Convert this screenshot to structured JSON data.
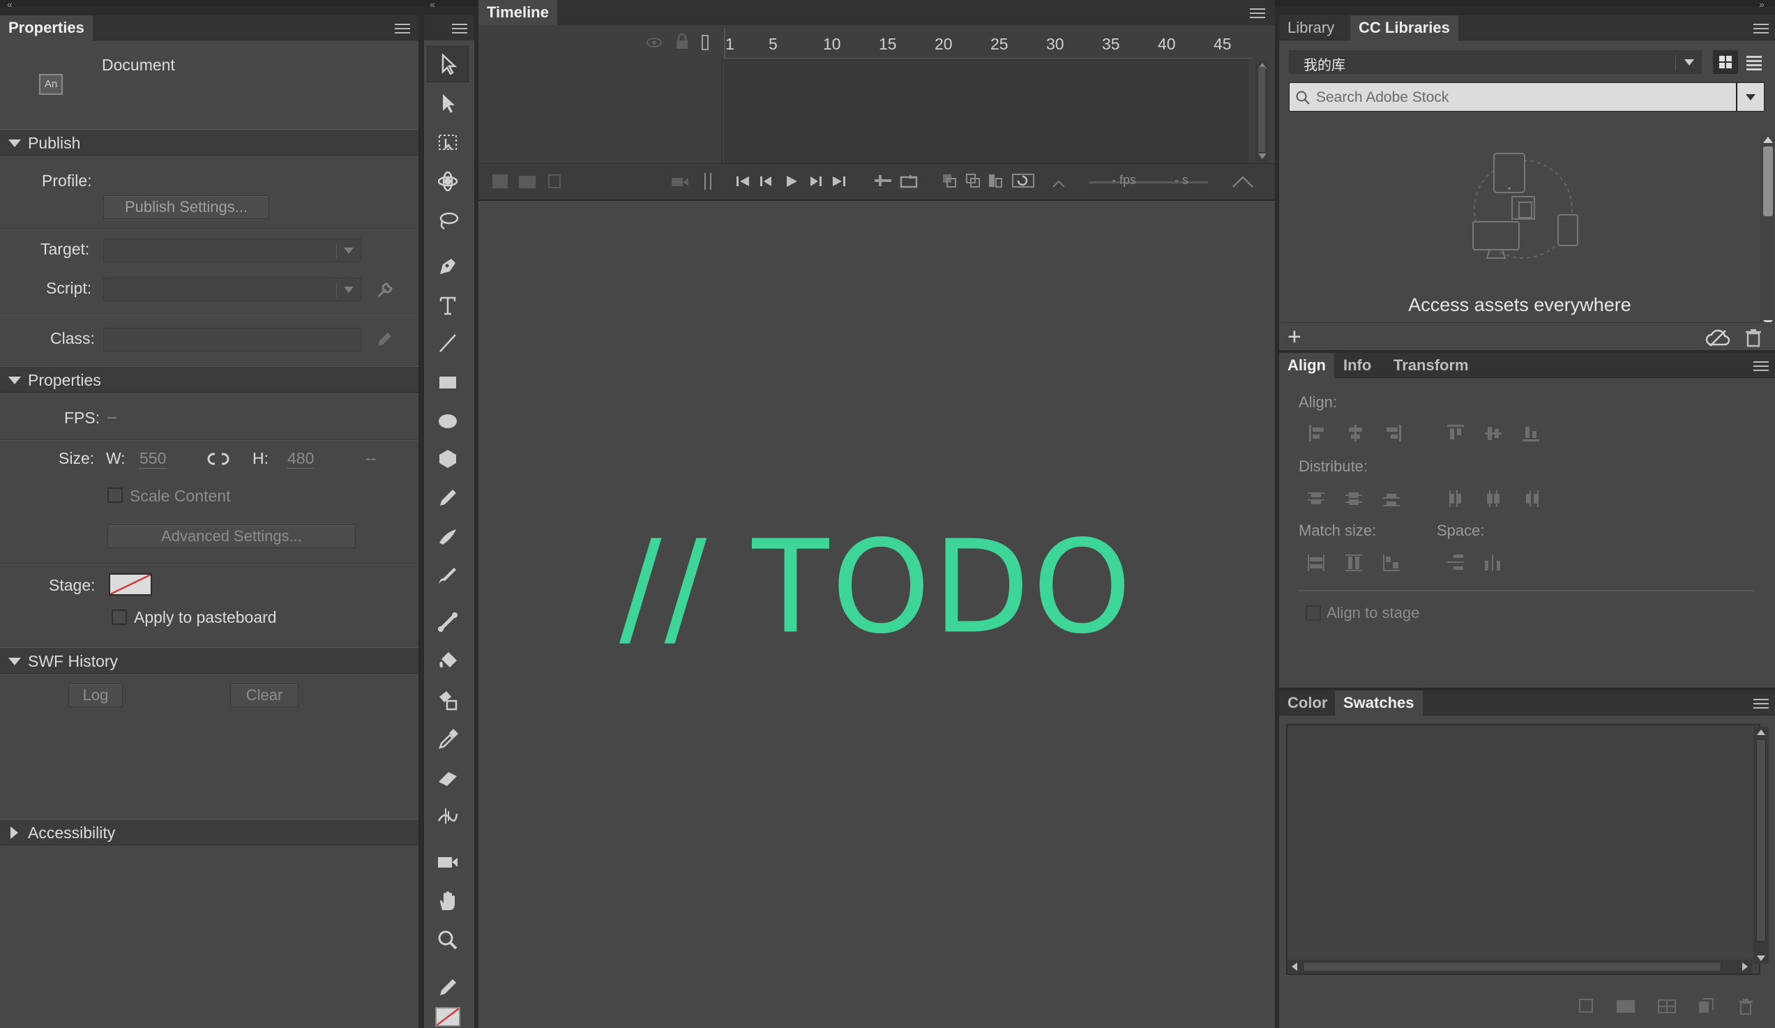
{
  "colors": {
    "accent": "#3dd598",
    "panel_bg": "#474747",
    "stage_bg": "#474747",
    "dark_bg": "#2b2b2b"
  },
  "properties_panel": {
    "tab": "Properties",
    "doc_label": "Document",
    "doc_icon_text": "An",
    "publish": {
      "header": "Publish",
      "profile_label": "Profile:",
      "publish_settings_button": "Publish Settings...",
      "target_label": "Target:",
      "script_label": "Script:",
      "class_label": "Class:"
    },
    "properties": {
      "header": "Properties",
      "fps_label": "FPS:",
      "fps_value": "–",
      "size_label": "Size:",
      "w_label": "W:",
      "w_value": "550",
      "h_label": "H:",
      "h_value": "480",
      "size_units": "--",
      "scale_content_label": "Scale Content",
      "advanced_settings_button": "Advanced Settings...",
      "stage_label": "Stage:",
      "apply_pasteboard_label": "Apply to pasteboard"
    },
    "swf_history": {
      "header": "SWF History",
      "log_button": "Log",
      "clear_button": "Clear"
    },
    "accessibility": {
      "header": "Accessibility"
    }
  },
  "toolbar": {
    "tools": [
      "selection-tool",
      "subselection-tool",
      "free-transform-tool",
      "3d-rotation-tool",
      "lasso-tool",
      "pen-tool",
      "text-tool",
      "line-tool",
      "rectangle-tool",
      "oval-tool",
      "polystar-tool",
      "pencil-tool",
      "paint-brush-tool",
      "brush-tool",
      "bone-tool",
      "paint-bucket-tool",
      "ink-bottle-tool",
      "eyedropper-tool",
      "eraser-tool",
      "width-tool",
      "camera-tool",
      "hand-tool",
      "zoom-tool",
      "stroke-color-tool",
      "fill-color-tool"
    ]
  },
  "timeline": {
    "tab": "Timeline",
    "frame_numbers": [
      "1",
      "5",
      "10",
      "15",
      "20",
      "25",
      "30",
      "35",
      "40",
      "45"
    ],
    "fps_text": "- fps",
    "seconds_text": "- s"
  },
  "stage": {
    "placeholder_text": "// TODO"
  },
  "library_panel": {
    "tabs": [
      "Library",
      "CC Libraries"
    ],
    "library_dropdown": "我的库",
    "search_placeholder": "Search Adobe Stock",
    "promo_text": "Access assets everywhere"
  },
  "align_panel": {
    "tabs": [
      "Align",
      "Info",
      "Transform"
    ],
    "align_label": "Align:",
    "distribute_label": "Distribute:",
    "match_size_label": "Match size:",
    "space_label": "Space:",
    "align_to_stage_label": "Align to stage"
  },
  "color_panel": {
    "tabs": [
      "Color",
      "Swatches"
    ]
  }
}
